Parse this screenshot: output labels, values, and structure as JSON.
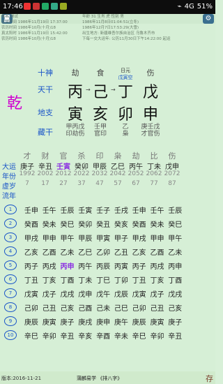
{
  "status": {
    "time": "17:46",
    "signal": "4G",
    "battery": "51%",
    "app_icons": [
      "#e33",
      "#c33",
      "#2a6",
      "#3a8",
      "#9a2"
    ]
  },
  "topbar": {
    "left_icon": "camera-icon",
    "right_icon": "gear-icon",
    "col1": [
      "姓名",
      "北京时间",
      "农历时间",
      "真太阳时",
      "农历时间"
    ],
    "col1_vals": [
      "测试",
      "1986年11月19日 17:37:00",
      "1986年10月(十月)18",
      "1986年11月19日 15:42:00",
      "1986年10月(十月)18"
    ],
    "col2": [
      "年龄",
      "31",
      "生肖",
      "虎",
      "性别",
      "男"
    ],
    "col2_vals": [
      "1986年11月8日01:04:51(立冬)",
      "1986年12月7日17:53:29(大雪)",
      "出生地方: 新疆维吾尔族自治区 乌鲁木齐市",
      "下每一交大运年: 公历11月30日下午14:22:00 起运"
    ]
  },
  "pillars": {
    "side": "乾",
    "labels": {
      "shishen": "十神",
      "tiangan": "天干",
      "dizhi": "地支",
      "canggan": "藏干"
    },
    "top_shishen": [
      "劫",
      "食",
      "日元",
      "伤"
    ],
    "top_note": "戊寅空",
    "tiangan": [
      "丙",
      "己",
      "丁",
      "戊"
    ],
    "dizhi": [
      "寅",
      "亥",
      "卯",
      "申"
    ],
    "canggan": [
      "甲丙戊",
      "壬甲",
      "乙",
      "庚壬戊"
    ],
    "canggan_shishen": [
      "印劫伤",
      "官印",
      "枭",
      "才官伤"
    ]
  },
  "dayun": {
    "labels": {
      "dayun": "大运",
      "year": "年份",
      "age": "虚岁",
      "liunian": "流年"
    },
    "shishen": [
      "才",
      "财",
      "官",
      "杀",
      "印",
      "枭",
      "劫",
      "比",
      "伤"
    ],
    "ganzhi": [
      "庚子",
      "辛丑",
      "壬寅",
      "癸卯",
      "甲辰",
      "乙巳",
      "丙午",
      "丁未",
      "戊申"
    ],
    "years": [
      "1992",
      "2002",
      "2012",
      "2022",
      "2032",
      "2042",
      "2052",
      "2062",
      "2072"
    ],
    "ages": [
      "7",
      "17",
      "27",
      "37",
      "47",
      "57",
      "67",
      "77",
      "87"
    ],
    "highlight_index": 2,
    "highlight_color": "#8a2be2"
  },
  "liunian": {
    "rows": [
      [
        "壬申",
        "壬午",
        "壬辰",
        "壬寅",
        "壬子",
        "壬戌",
        "壬申",
        "壬午",
        "壬辰"
      ],
      [
        "癸酉",
        "癸未",
        "癸巳",
        "癸卯",
        "癸丑",
        "癸亥",
        "癸酉",
        "癸未",
        "癸巳"
      ],
      [
        "甲戌",
        "甲申",
        "甲午",
        "甲辰",
        "甲寅",
        "甲子",
        "甲戌",
        "甲申",
        "甲午"
      ],
      [
        "乙亥",
        "乙酉",
        "乙未",
        "乙巳",
        "乙卯",
        "乙丑",
        "乙亥",
        "乙酉",
        "乙未"
      ],
      [
        "丙子",
        "丙戌",
        "丙申",
        "丙午",
        "丙辰",
        "丙寅",
        "丙子",
        "丙戌",
        "丙申"
      ],
      [
        "丁丑",
        "丁亥",
        "丁酉",
        "丁未",
        "丁巳",
        "丁卯",
        "丁丑",
        "丁亥",
        "丁酉"
      ],
      [
        "戊寅",
        "戊子",
        "戊戌",
        "戊申",
        "戊午",
        "戊辰",
        "戊寅",
        "戊子",
        "戊戌"
      ],
      [
        "己卯",
        "己丑",
        "己亥",
        "己酉",
        "己未",
        "己巳",
        "己卯",
        "己丑",
        "己亥"
      ],
      [
        "庚辰",
        "庚寅",
        "庚子",
        "庚戌",
        "庚申",
        "庚午",
        "庚辰",
        "庚寅",
        "庚子"
      ],
      [
        "辛巳",
        "辛卯",
        "辛丑",
        "辛亥",
        "辛酉",
        "辛未",
        "辛巳",
        "辛卯",
        "辛丑"
      ]
    ],
    "highlight_cell": {
      "row": 4,
      "col": 2,
      "color": "#8a2be2"
    }
  },
  "bottom": {
    "version": "版本:2016-11-21",
    "title": "蒲麟易学 《排八字》",
    "save": "存"
  }
}
